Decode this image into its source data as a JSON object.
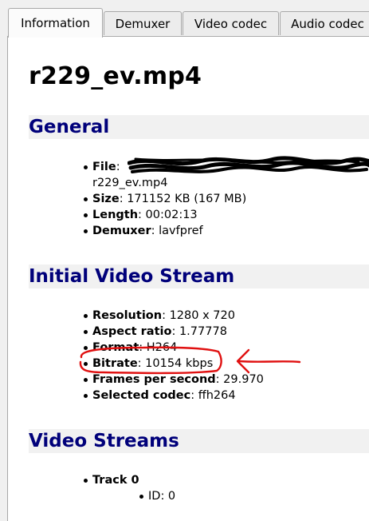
{
  "tabs": [
    {
      "label": "Information",
      "active": true
    },
    {
      "label": "Demuxer",
      "active": false
    },
    {
      "label": "Video codec",
      "active": false
    },
    {
      "label": "Audio codec",
      "active": false
    }
  ],
  "title": "r229_ev.mp4",
  "general": {
    "heading": "General",
    "file_key": "File",
    "file_value_cont": "r229_ev.mp4",
    "size_key": "Size",
    "size_value": "171152 KB (167 MB)",
    "length_key": "Length",
    "length_value": "00:02:13",
    "demuxer_key": "Demuxer",
    "demuxer_value": "lavfpref"
  },
  "video": {
    "heading": "Initial Video Stream",
    "resolution_key": "Resolution",
    "resolution_value": "1280 x 720",
    "aspect_key": "Aspect ratio",
    "aspect_value": "1.77778",
    "format_key": "Format",
    "format_value": "H264",
    "bitrate_key": "Bitrate",
    "bitrate_value": "10154 kbps",
    "fps_key": "Frames per second",
    "fps_value": "29.970",
    "codec_key": "Selected codec",
    "codec_value": "ffh264"
  },
  "streams": {
    "heading": "Video Streams",
    "track_label": "Track 0",
    "id_label": "ID: 0"
  },
  "colors": {
    "heading": "#00007a",
    "annotation": "#e01010"
  }
}
